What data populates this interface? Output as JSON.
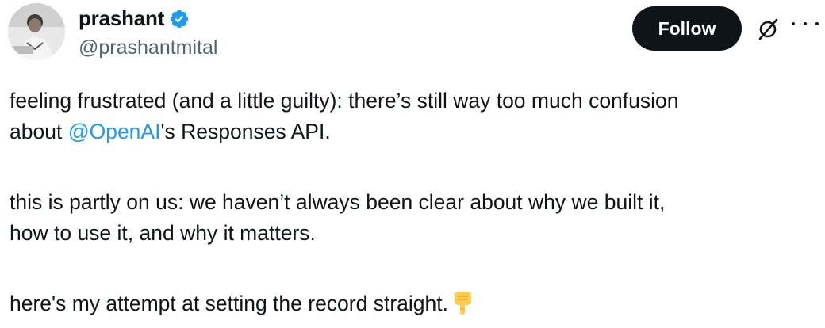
{
  "author": {
    "display_name": "prashant",
    "handle": "@prashantmital",
    "verified": true
  },
  "actions": {
    "follow_label": "Follow",
    "grok_icon": "grok-slash-icon",
    "more_icon": "ellipsis-icon"
  },
  "tweet": {
    "p1_line1": "feeling frustrated (and a little guilty): there’s still way too much confusion",
    "p1_line2_before": "about ",
    "p1_mention": "@OpenAI",
    "p1_line2_after": "'s Responses API.",
    "p2_line1": "this is partly on us: we haven’t always been clear about why we built it,",
    "p2_line2": "how to use it, and why it matters.",
    "p3_line1": "here's my attempt at setting the record straight.",
    "p3_emoji": "backhand-index-pointing-down-emoji"
  },
  "colors": {
    "text": "#0f1419",
    "secondary": "#536471",
    "link": "#1d9bf0",
    "follow_bg": "#0f1419",
    "verified": "#1d9bf0"
  }
}
